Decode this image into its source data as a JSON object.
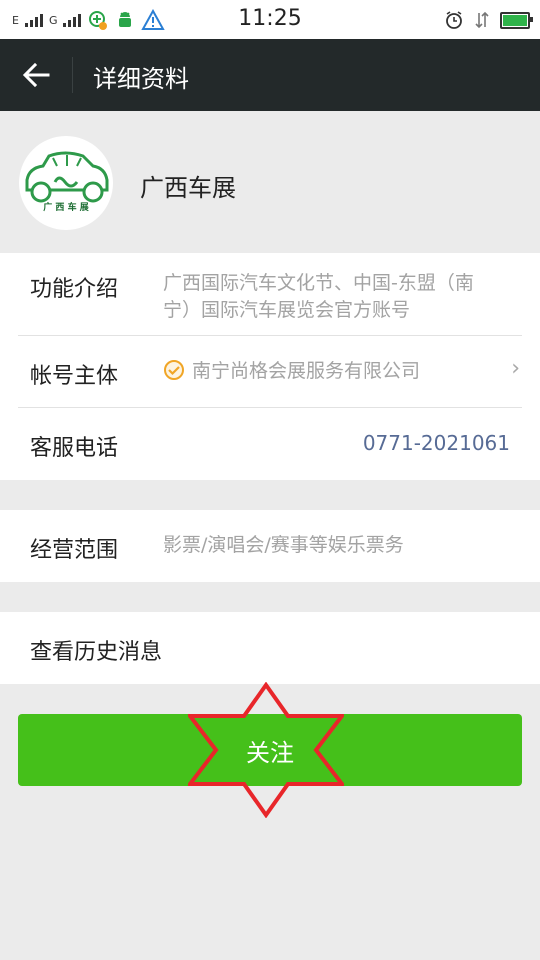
{
  "status_bar": {
    "sim1_letter": "E",
    "sim2_letter": "G",
    "time": "11:25"
  },
  "header": {
    "title": "详细资料"
  },
  "profile": {
    "name": "广西车展",
    "logo_text": "广 西 车 展"
  },
  "info": {
    "function_label": "功能介绍",
    "function_value_line1": "广西国际汽车文化节、中国-东盟（南",
    "function_value_line2": "宁）国际汽车展览会官方账号",
    "account_label": "帐号主体",
    "account_value": "南宁尚格会展服务有限公司",
    "phone_label": "客服电话",
    "phone_value": "0771-2021061"
  },
  "business": {
    "label": "经营范围",
    "value": "影票/演唱会/赛事等娱乐票务"
  },
  "history": {
    "label": "查看历史消息"
  },
  "follow_button": {
    "label": "关注"
  },
  "colors": {
    "header_bg": "#23292a",
    "follow_green": "#45c01a",
    "link_blue": "#576b95",
    "annotation_red": "#e8262a"
  }
}
